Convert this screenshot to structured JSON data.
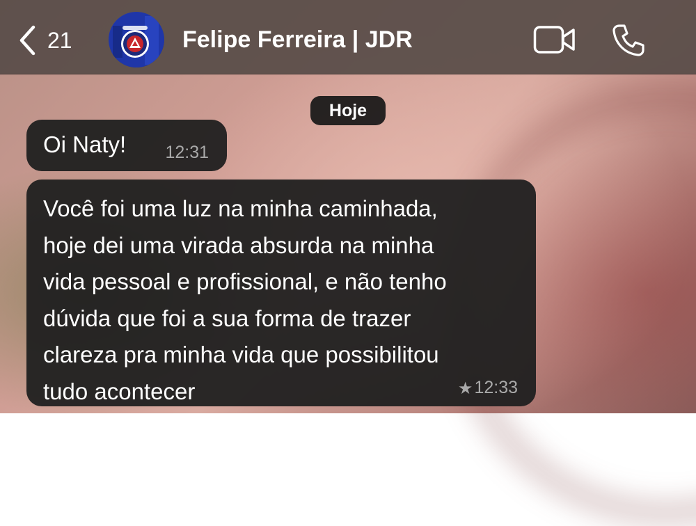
{
  "header": {
    "back_count": "21",
    "contact_name": "Felipe Ferreira | JDR",
    "icons": {
      "back": "chevron-left-icon",
      "video": "video-camera-icon",
      "call": "phone-icon"
    }
  },
  "chat": {
    "date_label": "Hoje",
    "messages": [
      {
        "text": "Oi Naty!",
        "time": "12:31",
        "starred": false
      },
      {
        "lines": [
          "Você foi uma luz na minha caminhada,",
          "hoje dei uma virada absurda na minha",
          "vida pessoal e profissional, e não tenho",
          "dúvida que foi a sua forma de trazer",
          "clareza pra minha vida que possibilitou",
          "tudo acontecer"
        ],
        "time": "12:33",
        "starred": true,
        "star_glyph": "★"
      }
    ]
  },
  "colors": {
    "header_bg": "#584c48",
    "bubble_bg": "#202020",
    "timestamp": "#a9a9a9",
    "text": "#ffffff"
  }
}
